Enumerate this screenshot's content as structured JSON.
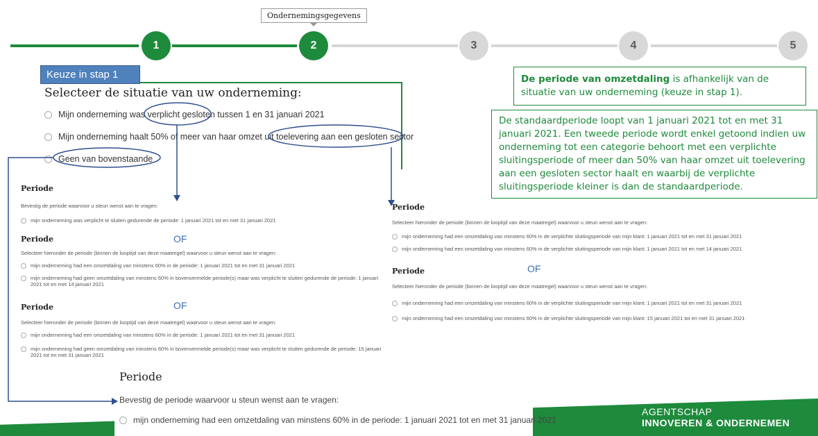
{
  "stepper": {
    "tooltip": "Ondernemingsgegevens",
    "steps": [
      "1",
      "2",
      "3",
      "4",
      "5"
    ]
  },
  "keuze_label": "Keuze in stap 1",
  "situatie": {
    "title": "Selecteer de situatie van uw onderneming:",
    "options": [
      "Mijn onderneming was verplicht gesloten tussen 1 en 31 januari 2021",
      "Mijn onderneming haalt 50% of meer van haar omzet uit toelevering aan een gesloten sector",
      "Geen van bovenstaande"
    ]
  },
  "info_periode": {
    "bold": "De periode van omzetdaling",
    "rest": " is afhankelijk van de situatie van uw onderneming (keuze in stap 1)."
  },
  "info_standaard": "De standaardperiode loopt van 1  januari 2021 tot en met 31 januari 2021. Een tweede periode wordt enkel getoond indien uw onderneming tot een categorie behoort met een verplichte sluitingsperiode of meer dan 50% van haar omzet uit toelevering aan een gesloten sector haalt en waarbij de verplichte sluitingsperiode kleiner is dan de standaardperiode.",
  "left_col": {
    "b1_title": "Periode",
    "b1_sub": "Bevestig de periode waarvoor u steun wenst aan te vragen:",
    "b1_opt": "mijn onderneming was verplicht te sluiten gedurende de periode: 1 januari 2021 tot en met 31 januari 2021",
    "b2_title": "Periode",
    "of1": "OF",
    "b2_sub": "Selecteer hieronder de periode (binnen de looptijd van deze maatregel) waarvoor u steun wenst aan te vragen:",
    "b2_opt1": "mijn onderneming had een omzetdaling van minstens 60% in de periode: 1 januari 2021 tot en met 31 januari 2021",
    "b2_opt2": "mijn onderneming had geen omzetdaling van minstens 60% in bovenvermelde periode(s) maar was verplicht te sluiten gedurende de periode: 1 januari 2021 tot en met 14 januari 2021",
    "b3_title": "Periode",
    "of2": "OF",
    "b3_sub": "Selecteer hieronder de periode (binnen de looptijd van deze maatregel) waarvoor u steun wenst aan te vragen:",
    "b3_opt1": "mijn onderneming had een omzetdaling van minstens 60% in de periode: 1 januari 2021 tot en met 31 januari 2021",
    "b3_opt2": "mijn onderneming had geen omzetdaling van minstens 60% in bovenvermelde periode(s) maar was verplicht te sluiten gedurende de periode: 15 januari 2021 tot en met 31 januari 2021"
  },
  "right_col": {
    "r1_title": "Periode",
    "r1_sub": "Selecteer hieronder de periode (binnen de looptijd van deze maatregel) waarvoor u steun wenst aan te vragen:",
    "r1_opt1": "mijn onderneming had een omzetdaling van minstens 60% in de verplichte sluitingsperiode van mijn klant: 1 januari 2021 tot en met 31 januari 2021",
    "r1_opt2": "mijn onderneming had een omzetdaling van minstens 60% in de verplichte sluitingsperiode van mijn klant: 1 januari 2021 tot en met 14 januari 2021",
    "r2_title": "Periode",
    "of": "OF",
    "r2_sub": "Selecteer hieronder de periode (binnen de looptijd van deze maatregel) waarvoor u steun wenst aan te vragen:",
    "r2_opt1": "mijn onderneming had een omzetdaling van minstens 60% in de verplichte sluitingsperiode van mijn klant: 1 januari 2021 tot en met 31 januari 2021",
    "r2_opt2": "mijn onderneming had een omzetdaling van minstens 60% in de verplichte sluitingsperiode van mijn klant: 15 januari 2021 tot en met 31 januari 2021"
  },
  "bottom": {
    "title": "Periode",
    "sub": "Bevestig de periode waarvoor u steun wenst aan te vragen:",
    "opt": "mijn onderneming had een omzetdaling van minstens 60% in de periode: 1 januari 2021 tot en met 31 januari 2021"
  },
  "logo": {
    "line1": "AGENTSCHAP",
    "line2": "INNOVEREN & ONDERNEMEN"
  },
  "colors": {
    "green": "#1e8a3c",
    "blue": "#4f81bd",
    "annotation": "#2f4f8f"
  }
}
